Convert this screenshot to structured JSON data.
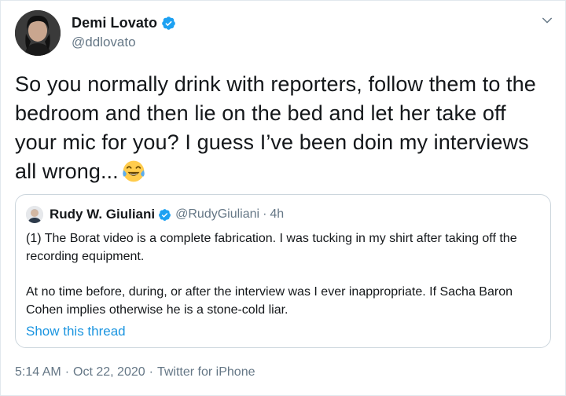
{
  "tweet": {
    "author": {
      "display_name": "Demi Lovato",
      "handle": "@ddlovato",
      "verified": true,
      "avatar_icon": "profile-photo"
    },
    "text": "So you normally drink with reporters, follow them to the bedroom and then lie on the bed and let her take off your mic for you? I guess I’ve been doin my interviews all wrong...",
    "emoji": "face-with-tears-of-joy",
    "menu_icon": "chevron-down-icon",
    "quoted": {
      "display_name": "Rudy W. Giuliani",
      "handle": "@RudyGiuliani",
      "separator": "·",
      "time": "4h",
      "verified": true,
      "paragraph_1": "(1) The Borat video is a complete fabrication. I was tucking in my shirt after taking off the recording equipment.",
      "paragraph_2": "At no time before, during, or after the interview was I ever inappropriate. If Sacha Baron Cohen implies otherwise he is a stone-cold liar.",
      "show_thread": "Show this thread"
    },
    "meta": {
      "time": "5:14 AM",
      "sep1": "·",
      "date": "Oct 22, 2020",
      "sep2": "·",
      "source": "Twitter for iPhone"
    }
  },
  "colors": {
    "verified_blue": "#1da1f2",
    "link_blue": "#1b95e0",
    "muted_gray": "#657786",
    "border": "#ccd6dd"
  }
}
